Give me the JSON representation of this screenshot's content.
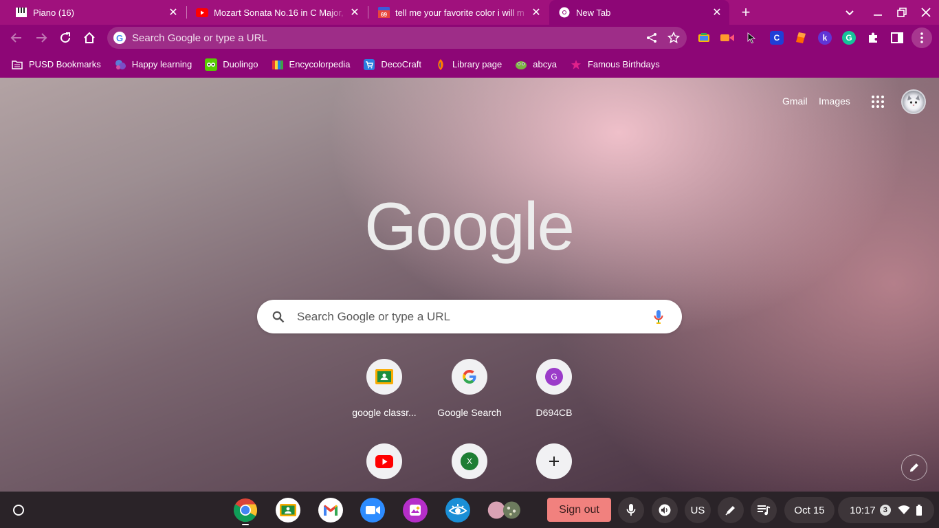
{
  "tabs": [
    {
      "title": "Piano (16)"
    },
    {
      "title": "Mozart Sonata No.16 in C Major,"
    },
    {
      "title": "tell me your favorite color i will m"
    },
    {
      "title": "New Tab"
    }
  ],
  "omnibox": {
    "placeholder": "Search Google or type a URL"
  },
  "bookmarks": [
    {
      "label": "PUSD Bookmarks"
    },
    {
      "label": "Happy learning"
    },
    {
      "label": "Duolingo"
    },
    {
      "label": "Encycolorpedia"
    },
    {
      "label": "DecoCraft"
    },
    {
      "label": "Library page"
    },
    {
      "label": "abcya"
    },
    {
      "label": "Famous Birthdays"
    }
  ],
  "ntp": {
    "gmail": "Gmail",
    "images": "Images",
    "logo": "Google",
    "search_placeholder": "Search Google or type a URL",
    "shortcuts": [
      {
        "label": "google classr...",
        "icon": "classroom-icon"
      },
      {
        "label": "Google Search",
        "icon": "google-g-icon"
      },
      {
        "label": "D694CB",
        "icon": "letter-g-icon",
        "letter": "G"
      },
      {
        "label": "",
        "icon": "youtube-icon"
      },
      {
        "label": "",
        "icon": "excel-icon",
        "letter": "X"
      },
      {
        "label": "",
        "icon": "plus-icon"
      }
    ]
  },
  "shelf": {
    "sign_out": "Sign out",
    "ime": "US",
    "date": "Oct 15",
    "time": "10:17",
    "notifications": "3"
  },
  "colors": {
    "frame": "#a0117d",
    "toolbar": "#8d0676",
    "shelf": "#2a2328",
    "signout": "#f1817e"
  }
}
